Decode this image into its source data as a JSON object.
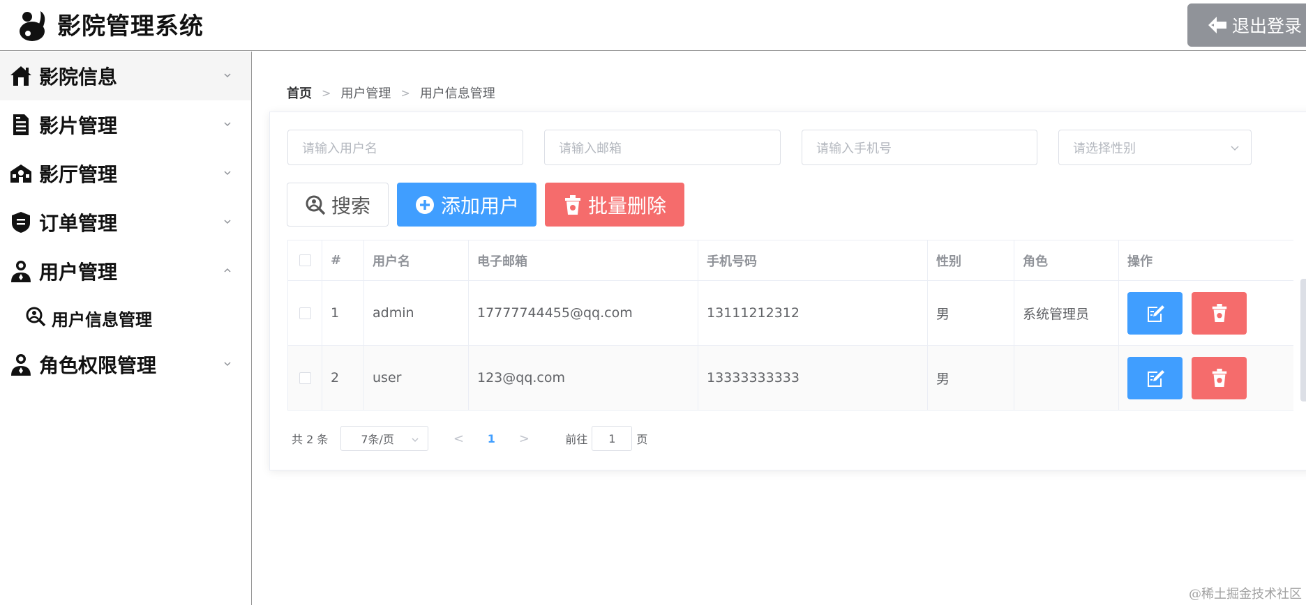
{
  "app": {
    "title": "影院管理系统",
    "logout_label": "退出登录"
  },
  "sidebar": {
    "items": [
      {
        "label": "影院信息",
        "icon": "home-icon"
      },
      {
        "label": "影片管理",
        "icon": "document-icon"
      },
      {
        "label": "影厅管理",
        "icon": "building-icon"
      },
      {
        "label": "订单管理",
        "icon": "shield-icon"
      },
      {
        "label": "用户管理",
        "icon": "user-icon"
      },
      {
        "label": "角色权限管理",
        "icon": "user-icon"
      }
    ],
    "sub_items": [
      {
        "label": "用户信息管理",
        "icon": "search-user-icon"
      }
    ]
  },
  "breadcrumb": {
    "home": "首页",
    "level1": "用户管理",
    "level2": "用户信息管理"
  },
  "filters": {
    "username_placeholder": "请输入用户名",
    "email_placeholder": "请输入邮箱",
    "phone_placeholder": "请输入手机号",
    "gender_placeholder": "请选择性别"
  },
  "actions": {
    "search": "搜索",
    "add": "添加用户",
    "batch_delete": "批量删除"
  },
  "table": {
    "headers": [
      "#",
      "用户名",
      "电子邮箱",
      "手机号码",
      "性别",
      "角色",
      "操作"
    ],
    "rows": [
      {
        "index": "1",
        "username": "admin",
        "email": "17777744455@qq.com",
        "phone": "13111212312",
        "gender": "男",
        "role": "系统管理员"
      },
      {
        "index": "2",
        "username": "user",
        "email": "123@qq.com",
        "phone": "13333333333",
        "gender": "男",
        "role": ""
      }
    ]
  },
  "pagination": {
    "total": "共 2 条",
    "page_size": "7条/页",
    "current_page": "1",
    "goto_label": "前往",
    "goto_value": "1",
    "page_suffix": "页"
  },
  "watermark": "@稀土掘金技术社区",
  "colors": {
    "primary": "#409eff",
    "danger": "#f56c6c",
    "info": "#909399"
  }
}
